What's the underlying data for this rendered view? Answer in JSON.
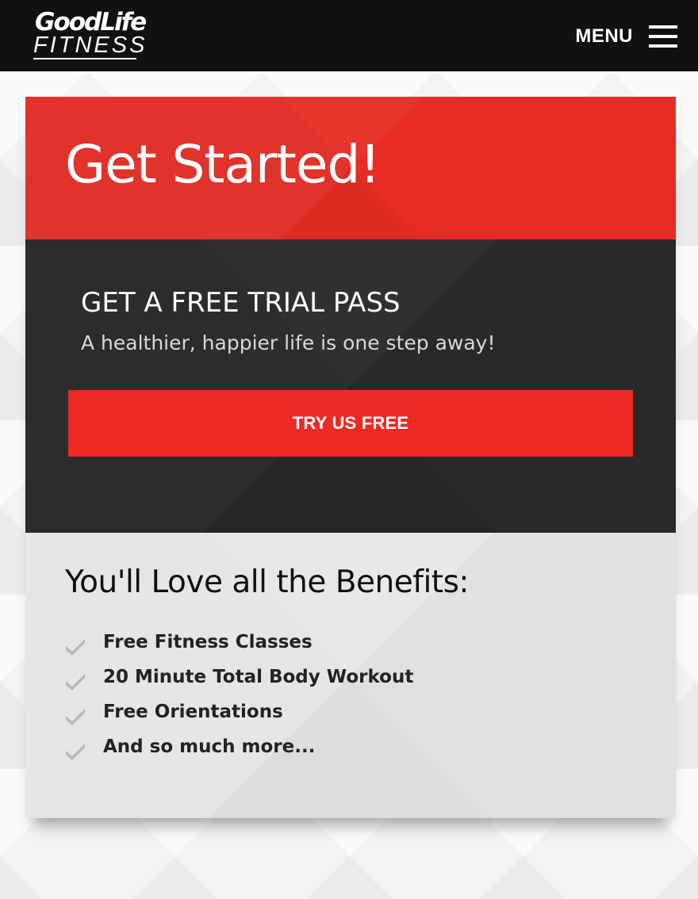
{
  "header": {
    "logo_line1": "GoodLife",
    "logo_line2": "FITNESS",
    "menu_label": "MENU"
  },
  "hero": {
    "title": "Get Started!"
  },
  "trial": {
    "title": "GET A FREE TRIAL PASS",
    "subtitle": "A healthier, happier life is one step away!",
    "button_label": "TRY US FREE"
  },
  "benefits": {
    "title": "You'll Love all the Benefits:",
    "items": [
      {
        "label": "Free Fitness Classes",
        "icon": "check-icon"
      },
      {
        "label": "20 Minute Total Body Workout",
        "icon": "check-icon"
      },
      {
        "label": "Free Orientations",
        "icon": "check-icon"
      },
      {
        "label": "And so much more...",
        "icon": "check-icon"
      }
    ]
  },
  "colors": {
    "header_bg": "#111111",
    "brand_red": "#e62c24",
    "button_red": "#ee2a24",
    "dark_section": "#252525",
    "benefits_bg": "#e1e1e1",
    "check_gray": "#b8b8b8"
  }
}
